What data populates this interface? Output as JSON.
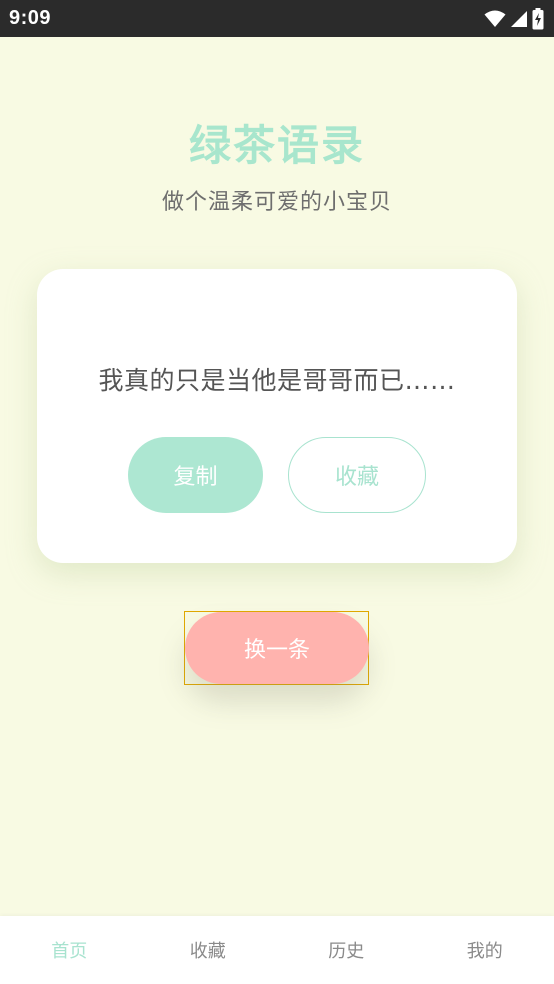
{
  "status_bar": {
    "time": "9:09",
    "icons": [
      "wifi-icon",
      "cell-signal-icon",
      "battery-charging-icon"
    ]
  },
  "header": {
    "title": "绿茶语录",
    "subtitle": "做个温柔可爱的小宝贝"
  },
  "card": {
    "quote": "我真的只是当他是哥哥而已……",
    "copy_label": "复制",
    "favorite_label": "收藏"
  },
  "actions": {
    "next_label": "换一条"
  },
  "tabs": [
    {
      "label": "首页",
      "active": true
    },
    {
      "label": "收藏",
      "active": false
    },
    {
      "label": "历史",
      "active": false
    },
    {
      "label": "我的",
      "active": false
    }
  ],
  "colors": {
    "background": "#f8fae3",
    "accent_green": "#a8e6cd",
    "accent_pink": "#ffb3ae",
    "status_bar": "#2b2b2b"
  }
}
